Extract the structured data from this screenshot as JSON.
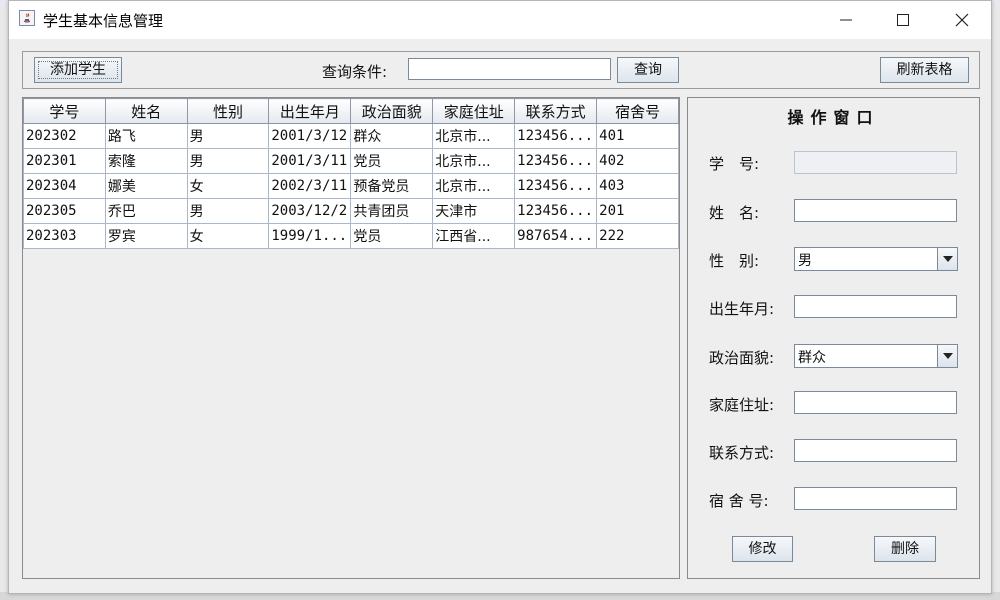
{
  "window": {
    "title": "学生基本信息管理"
  },
  "toolbar": {
    "add_label": "添加学生",
    "query_label": "查询条件:",
    "query_value": "",
    "query_button": "查询",
    "refresh_label": "刷新表格"
  },
  "table": {
    "columns": [
      "学号",
      "姓名",
      "性别",
      "出生年月",
      "政治面貌",
      "家庭住址",
      "联系方式",
      "宿舍号"
    ],
    "rows": [
      [
        "202302",
        "路飞",
        "男",
        "2001/3/12",
        "群众",
        "北京市...",
        "123456...",
        "401"
      ],
      [
        "202301",
        "索隆",
        "男",
        "2001/3/11",
        "党员",
        "北京市...",
        "123456...",
        "402"
      ],
      [
        "202304",
        "娜美",
        "女",
        "2002/3/11",
        "预备党员",
        "北京市...",
        "123456...",
        "403"
      ],
      [
        "202305",
        "乔巴",
        "男",
        "2003/12/2",
        "共青团员",
        "天津市",
        "123456...",
        "201"
      ],
      [
        "202303",
        "罗宾",
        "女",
        "1999/1...",
        "党员",
        "江西省...",
        "987654...",
        "222"
      ]
    ]
  },
  "form": {
    "title": "操作窗口",
    "labels": {
      "id": "学　号:",
      "name": "姓　名:",
      "gender": "性　别:",
      "birth": "出生年月:",
      "political": "政治面貌:",
      "address": "家庭住址:",
      "contact": "联系方式:",
      "dorm": "宿 舍 号:"
    },
    "values": {
      "id": "",
      "name": "",
      "gender": "男",
      "birth": "",
      "political": "群众",
      "address": "",
      "contact": "",
      "dorm": ""
    },
    "modify_label": "修改",
    "delete_label": "删除"
  },
  "colors": {
    "button_border": "#7a8a99",
    "grid_border": "#a9b7c6",
    "window_bg": "#eeeeee"
  }
}
